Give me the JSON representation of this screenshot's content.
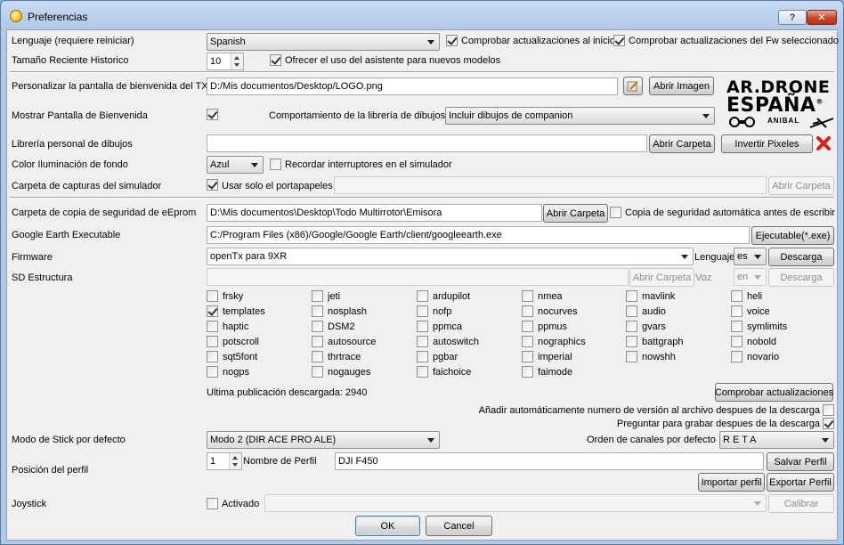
{
  "window": {
    "title": "Preferencias",
    "help": "?",
    "close": "✕"
  },
  "language": {
    "label": "Lenguaje (requiere reiniciar)",
    "value": "Spanish",
    "check_updates_start": "Comprobar actualizaciones al inicio",
    "check_updates_fw": "Comprobar actualizaciones del Fw seleccionado"
  },
  "history": {
    "label": "Tamaño Reciente Historico",
    "value": "10",
    "wizard": "Ofrecer el uso del asistente para nuevos modelos"
  },
  "splash": {
    "label": "Personalizar la pantalla de bienvenida del TX",
    "path": "D:/Mis documentos/Desktop/LOGO.png",
    "open_image": "Abrir Imagen",
    "show_label": "Mostrar Pantalla de Bienvenida",
    "lib_behavior_label": "Comportamiento de la librería de dibujos",
    "lib_behavior_value": "Incluir dibujos de companion"
  },
  "logo": {
    "line1": "AR.DRONE",
    "line2": "ESPAÑA",
    "reg": "®",
    "line3": "ANIBAL"
  },
  "library": {
    "label": "Librería personal de dibujos",
    "path": "",
    "open_folder": "Abrir Carpeta",
    "invert": "Invertir Pixeles"
  },
  "backlight": {
    "label": "Color Iluminación de fondo",
    "value": "Azul",
    "remember_switches": "Recordar interruptores en el simulador"
  },
  "sim_captures": {
    "label": "Carpeta de capturas del simulador",
    "clipboard_only": "Usar solo el portapapeles",
    "path": "",
    "open_folder": "Abrir Carpeta"
  },
  "backup": {
    "label": "Carpeta de copia de seguridad de eEprom",
    "path": "D:\\Mis documentos\\Desktop\\Todo Multirrotor\\Emisora",
    "open_folder": "Abrir Carpeta",
    "auto_backup": "Copia de seguridad automática antes de escribir"
  },
  "google_earth": {
    "label": "Google Earth Executable",
    "path": "C:/Program Files (x86)/Google/Google Earth/client/googleearth.exe",
    "exe_button": "Ejecutable(*.exe)"
  },
  "firmware": {
    "label": "Firmware",
    "value": "openTx para 9XR",
    "lang_label": "Lenguaje",
    "lang_value": "es",
    "download": "Descarga"
  },
  "sd": {
    "label": "SD Estructura",
    "path": "",
    "open_folder": "Abrir Carpeta",
    "voice_label": "Voz",
    "voice_value": "en",
    "download": "Descarga"
  },
  "options": [
    {
      "name": "frsky",
      "checked": false
    },
    {
      "name": "jeti",
      "checked": false
    },
    {
      "name": "ardupilot",
      "checked": false
    },
    {
      "name": "nmea",
      "checked": false
    },
    {
      "name": "mavlink",
      "checked": false
    },
    {
      "name": "heli",
      "checked": false
    },
    {
      "name": "templates",
      "checked": true
    },
    {
      "name": "nosplash",
      "checked": false
    },
    {
      "name": "nofp",
      "checked": false
    },
    {
      "name": "nocurves",
      "checked": false
    },
    {
      "name": "audio",
      "checked": false
    },
    {
      "name": "voice",
      "checked": false
    },
    {
      "name": "haptic",
      "checked": false
    },
    {
      "name": "DSM2",
      "checked": false
    },
    {
      "name": "ppmca",
      "checked": false
    },
    {
      "name": "ppmus",
      "checked": false
    },
    {
      "name": "gvars",
      "checked": false
    },
    {
      "name": "symlimits",
      "checked": false
    },
    {
      "name": "potscroll",
      "checked": false
    },
    {
      "name": "autosource",
      "checked": false
    },
    {
      "name": "autoswitch",
      "checked": false
    },
    {
      "name": "nographics",
      "checked": false
    },
    {
      "name": "battgraph",
      "checked": false
    },
    {
      "name": "nobold",
      "checked": false
    },
    {
      "name": "sqt5font",
      "checked": false
    },
    {
      "name": "thrtrace",
      "checked": false
    },
    {
      "name": "pgbar",
      "checked": false
    },
    {
      "name": "imperial",
      "checked": false
    },
    {
      "name": "nowshh",
      "checked": false
    },
    {
      "name": "novario",
      "checked": false
    },
    {
      "name": "nogps",
      "checked": false
    },
    {
      "name": "nogauges",
      "checked": false
    },
    {
      "name": "faichoice",
      "checked": false
    },
    {
      "name": "faimode",
      "checked": false
    }
  ],
  "updates": {
    "last_download": "Ultima publicación descargada: 2940",
    "check_button": "Comprobar actualizaciones",
    "add_version": "Añadir automáticamente numero de versión al archivo despues de la descarga",
    "ask_burn": "Preguntar para grabar despues de la descarga"
  },
  "stick": {
    "label": "Modo de Stick por defecto",
    "value": "Modo 2 (DIR ACE PRO ALE)",
    "channel_order_label": "Orden de canales por defecto",
    "channel_order_value": "R E T A"
  },
  "profile": {
    "label": "Posición del perfil",
    "position": "1",
    "name_label": "Nombre de Perfil",
    "name_value": "DJI F450",
    "save": "Salvar Perfil",
    "import": "Importar perfil",
    "export": "Exportar Perfil"
  },
  "joystick": {
    "label": "Joystick",
    "enabled": "Activado",
    "device": "",
    "calibrate": "Calibrar"
  },
  "dialog": {
    "ok": "OK",
    "cancel": "Cancel"
  },
  "colors": {
    "titlebar": "#b2c9e6",
    "client": "#f0f0f0",
    "close": "#c8452f",
    "x_icon": "#d9201a"
  }
}
